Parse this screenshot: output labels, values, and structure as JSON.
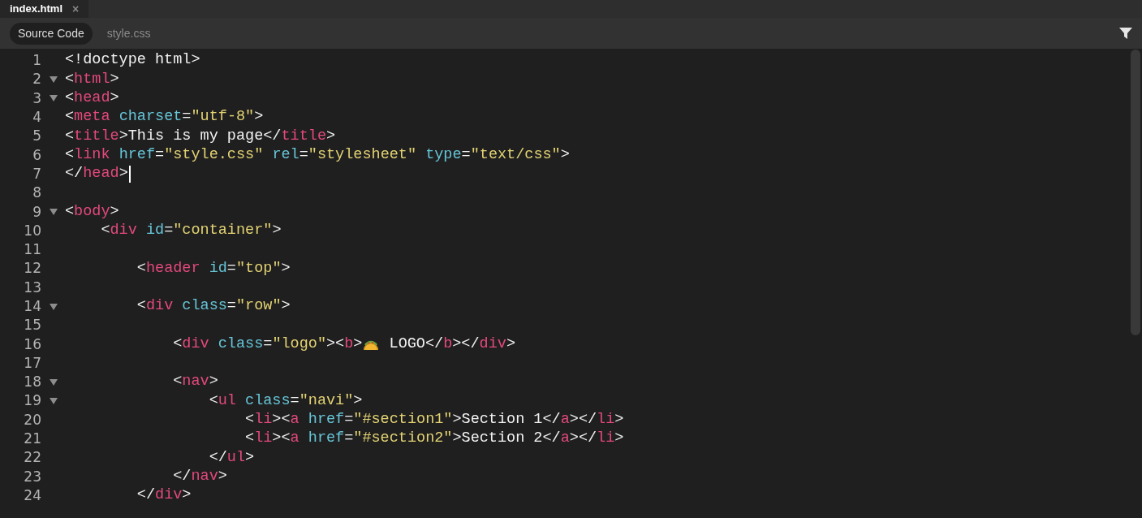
{
  "file_tabs": [
    {
      "label": "index.html",
      "selected": true,
      "close": "×"
    }
  ],
  "view_tabs": [
    {
      "label": "Source Code",
      "selected": true
    },
    {
      "label": "style.css",
      "selected": false
    }
  ],
  "lines": [
    {
      "number": "1",
      "foldable": false,
      "cursor": false,
      "tokens": [
        {
          "kind": "punct",
          "text": "<!doctype html>"
        }
      ]
    },
    {
      "number": "2",
      "foldable": true,
      "cursor": false,
      "tokens": [
        {
          "kind": "punct",
          "text": "<"
        },
        {
          "kind": "tag",
          "text": "html"
        },
        {
          "kind": "punct",
          "text": ">"
        }
      ]
    },
    {
      "number": "3",
      "foldable": true,
      "cursor": false,
      "tokens": [
        {
          "kind": "punct",
          "text": "<"
        },
        {
          "kind": "tag",
          "text": "head"
        },
        {
          "kind": "punct",
          "text": ">"
        }
      ]
    },
    {
      "number": "4",
      "foldable": false,
      "cursor": false,
      "tokens": [
        {
          "kind": "punct",
          "text": "<"
        },
        {
          "kind": "tag",
          "text": "meta"
        },
        {
          "kind": "attr",
          "text": " charset"
        },
        {
          "kind": "punct",
          "text": "="
        },
        {
          "kind": "string",
          "text": "\"utf-8\""
        },
        {
          "kind": "punct",
          "text": ">"
        }
      ]
    },
    {
      "number": "5",
      "foldable": false,
      "cursor": false,
      "tokens": [
        {
          "kind": "punct",
          "text": "<"
        },
        {
          "kind": "tag",
          "text": "title"
        },
        {
          "kind": "punct",
          "text": ">This is my page</"
        },
        {
          "kind": "tag",
          "text": "title"
        },
        {
          "kind": "punct",
          "text": ">"
        }
      ]
    },
    {
      "number": "6",
      "foldable": false,
      "cursor": false,
      "tokens": [
        {
          "kind": "punct",
          "text": "<"
        },
        {
          "kind": "tag",
          "text": "link"
        },
        {
          "kind": "attr",
          "text": " href"
        },
        {
          "kind": "punct",
          "text": "="
        },
        {
          "kind": "string",
          "text": "\"style.css\""
        },
        {
          "kind": "attr",
          "text": " rel"
        },
        {
          "kind": "punct",
          "text": "="
        },
        {
          "kind": "string",
          "text": "\"stylesheet\""
        },
        {
          "kind": "attr",
          "text": " type"
        },
        {
          "kind": "punct",
          "text": "="
        },
        {
          "kind": "string",
          "text": "\"text/css\""
        },
        {
          "kind": "punct",
          "text": ">"
        }
      ]
    },
    {
      "number": "7",
      "foldable": false,
      "cursor": true,
      "tokens": [
        {
          "kind": "punct",
          "text": "</"
        },
        {
          "kind": "tag",
          "text": "head"
        },
        {
          "kind": "punct",
          "text": ">"
        }
      ]
    },
    {
      "number": "8",
      "foldable": false,
      "cursor": false
    },
    {
      "number": "9",
      "foldable": true,
      "cursor": false,
      "tokens": [
        {
          "kind": "punct",
          "text": "<"
        },
        {
          "kind": "tag",
          "text": "body"
        },
        {
          "kind": "punct",
          "text": ">"
        }
      ]
    },
    {
      "number": "10",
      "foldable": false,
      "cursor": false,
      "tokens": [
        {
          "kind": "punct",
          "text": "    <"
        },
        {
          "kind": "tag",
          "text": "div"
        },
        {
          "kind": "attr",
          "text": " id"
        },
        {
          "kind": "punct",
          "text": "="
        },
        {
          "kind": "string",
          "text": "\"container\""
        },
        {
          "kind": "punct",
          "text": ">"
        }
      ]
    },
    {
      "number": "11",
      "foldable": false,
      "cursor": false
    },
    {
      "number": "12",
      "foldable": false,
      "cursor": false,
      "tokens": [
        {
          "kind": "punct",
          "text": "        <"
        },
        {
          "kind": "tag",
          "text": "header"
        },
        {
          "kind": "attr",
          "text": " id"
        },
        {
          "kind": "punct",
          "text": "="
        },
        {
          "kind": "string",
          "text": "\"top\""
        },
        {
          "kind": "punct",
          "text": ">"
        }
      ]
    },
    {
      "number": "13",
      "foldable": false,
      "cursor": false
    },
    {
      "number": "14",
      "foldable": true,
      "cursor": false,
      "tokens": [
        {
          "kind": "punct",
          "text": "        <"
        },
        {
          "kind": "tag",
          "text": "div"
        },
        {
          "kind": "attr",
          "text": " class"
        },
        {
          "kind": "punct",
          "text": "="
        },
        {
          "kind": "string",
          "text": "\"row\""
        },
        {
          "kind": "punct",
          "text": ">"
        }
      ]
    },
    {
      "number": "15",
      "foldable": false,
      "cursor": false
    },
    {
      "number": "16",
      "foldable": false,
      "cursor": false,
      "tokens": [
        {
          "kind": "punct",
          "text": "            <"
        },
        {
          "kind": "tag",
          "text": "div"
        },
        {
          "kind": "attr",
          "text": " class"
        },
        {
          "kind": "punct",
          "text": "="
        },
        {
          "kind": "string",
          "text": "\"logo\""
        },
        {
          "kind": "punct",
          "text": "><"
        },
        {
          "kind": "tag",
          "text": "b"
        },
        {
          "kind": "punct",
          "text": ">"
        },
        {
          "kind": "emoji"
        },
        {
          "kind": "punct",
          "text": " LOGO</"
        },
        {
          "kind": "tag",
          "text": "b"
        },
        {
          "kind": "punct",
          "text": "></"
        },
        {
          "kind": "tag",
          "text": "div"
        },
        {
          "kind": "punct",
          "text": ">"
        }
      ]
    },
    {
      "number": "17",
      "foldable": false,
      "cursor": false
    },
    {
      "number": "18",
      "foldable": true,
      "cursor": false,
      "tokens": [
        {
          "kind": "punct",
          "text": "            <"
        },
        {
          "kind": "tag",
          "text": "nav"
        },
        {
          "kind": "punct",
          "text": ">"
        }
      ]
    },
    {
      "number": "19",
      "foldable": true,
      "cursor": false,
      "tokens": [
        {
          "kind": "punct",
          "text": "                <"
        },
        {
          "kind": "tag",
          "text": "ul"
        },
        {
          "kind": "attr",
          "text": " class"
        },
        {
          "kind": "punct",
          "text": "="
        },
        {
          "kind": "string",
          "text": "\"navi\""
        },
        {
          "kind": "punct",
          "text": ">"
        }
      ]
    },
    {
      "number": "20",
      "foldable": false,
      "cursor": false,
      "tokens": [
        {
          "kind": "punct",
          "text": "                    <"
        },
        {
          "kind": "tag",
          "text": "li"
        },
        {
          "kind": "punct",
          "text": "><"
        },
        {
          "kind": "tag",
          "text": "a"
        },
        {
          "kind": "attr",
          "text": " href"
        },
        {
          "kind": "punct",
          "text": "="
        },
        {
          "kind": "string",
          "text": "\"#section1\""
        },
        {
          "kind": "punct",
          "text": ">Section 1</"
        },
        {
          "kind": "tag",
          "text": "a"
        },
        {
          "kind": "punct",
          "text": "></"
        },
        {
          "kind": "tag",
          "text": "li"
        },
        {
          "kind": "punct",
          "text": ">"
        }
      ]
    },
    {
      "number": "21",
      "foldable": false,
      "cursor": false,
      "tokens": [
        {
          "kind": "punct",
          "text": "                    <"
        },
        {
          "kind": "tag",
          "text": "li"
        },
        {
          "kind": "punct",
          "text": "><"
        },
        {
          "kind": "tag",
          "text": "a"
        },
        {
          "kind": "attr",
          "text": " href"
        },
        {
          "kind": "punct",
          "text": "="
        },
        {
          "kind": "string",
          "text": "\"#section2\""
        },
        {
          "kind": "punct",
          "text": ">Section 2</"
        },
        {
          "kind": "tag",
          "text": "a"
        },
        {
          "kind": "punct",
          "text": "></"
        },
        {
          "kind": "tag",
          "text": "li"
        },
        {
          "kind": "punct",
          "text": ">"
        }
      ]
    },
    {
      "number": "22",
      "foldable": false,
      "cursor": false,
      "tokens": [
        {
          "kind": "punct",
          "text": "                </"
        },
        {
          "kind": "tag",
          "text": "ul"
        },
        {
          "kind": "punct",
          "text": ">"
        }
      ]
    },
    {
      "number": "23",
      "foldable": false,
      "cursor": false,
      "tokens": [
        {
          "kind": "punct",
          "text": "            </"
        },
        {
          "kind": "tag",
          "text": "nav"
        },
        {
          "kind": "punct",
          "text": ">"
        }
      ]
    },
    {
      "number": "24",
      "foldable": false,
      "cursor": false,
      "tokens": [
        {
          "kind": "punct",
          "text": "        </"
        },
        {
          "kind": "tag",
          "text": "div"
        },
        {
          "kind": "punct",
          "text": ">"
        }
      ]
    }
  ]
}
